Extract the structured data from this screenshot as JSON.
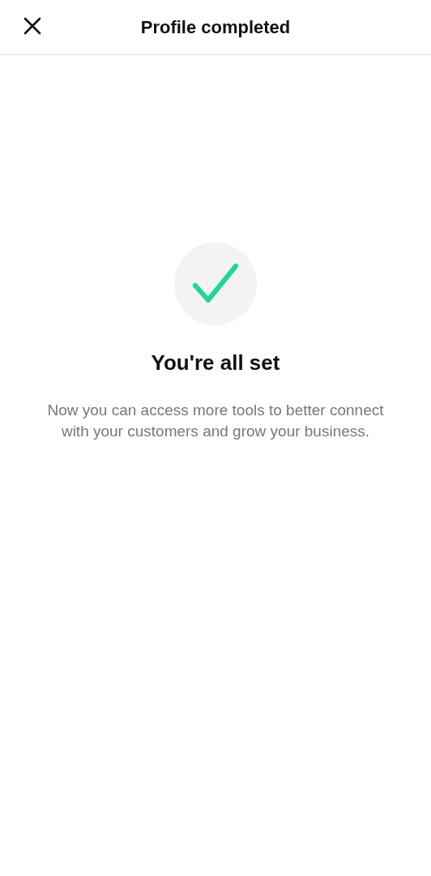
{
  "header": {
    "title": "Profile completed"
  },
  "success": {
    "heading": "You're all set",
    "message": "Now you can access more tools to better connect with your customers and grow your business."
  }
}
